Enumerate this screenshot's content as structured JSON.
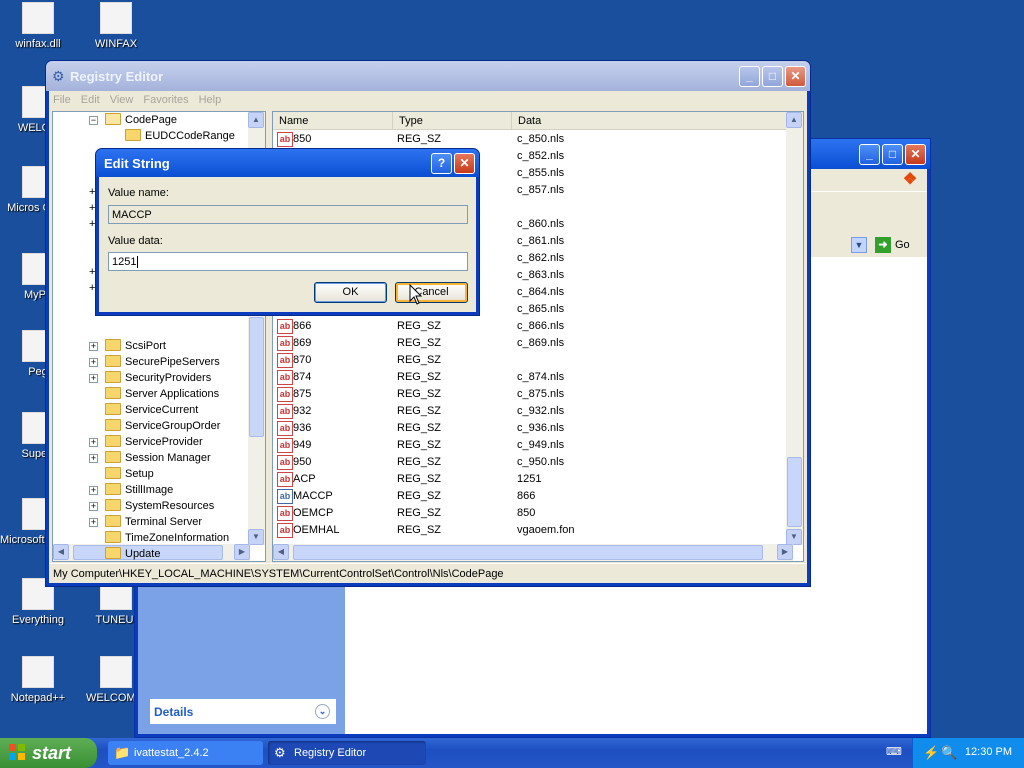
{
  "desktop": {
    "icons": [
      {
        "label": "winfax.dll",
        "icon": "dll-file-icon"
      },
      {
        "label": "WINFAX",
        "icon": "text-document-icon"
      },
      {
        "label": "WELCO",
        "icon": "folder-icon"
      },
      {
        "label": "Micros Outlo",
        "icon": "outlook-icon"
      },
      {
        "label": "MyPa",
        "icon": "mypal-icon"
      },
      {
        "label": "Peg",
        "icon": "pegasus-icon"
      },
      {
        "label": "Superr",
        "icon": "super-icon"
      },
      {
        "label": "Microsoft Studio :",
        "icon": "studio-icon"
      },
      {
        "label": "Everything",
        "icon": "everything-search-icon"
      },
      {
        "label": "TUNEUI",
        "icon": "text-document-icon"
      },
      {
        "label": "Notepad++",
        "icon": "notepadpp-icon"
      },
      {
        "label": "WELCOME.",
        "icon": "text-document-icon"
      }
    ]
  },
  "background_window": {
    "details_label": "Details",
    "go_label": "Go",
    "colors": {
      "title": "#0a4fd4",
      "pane": "#7ba2e7"
    }
  },
  "registry_editor": {
    "title": "Registry Editor",
    "menu": [
      "File",
      "Edit",
      "View",
      "Favorites",
      "Help"
    ],
    "tree_top": [
      {
        "label": "CodePage",
        "expanded": true
      },
      {
        "label": "EUDCCodeRange"
      }
    ],
    "tree_items": [
      {
        "label": "ScsiPort",
        "expander": "+"
      },
      {
        "label": "SecurePipeServers",
        "expander": "+"
      },
      {
        "label": "SecurityProviders",
        "expander": "+"
      },
      {
        "label": "Server Applications",
        "expander": ""
      },
      {
        "label": "ServiceCurrent",
        "expander": ""
      },
      {
        "label": "ServiceGroupOrder",
        "expander": ""
      },
      {
        "label": "ServiceProvider",
        "expander": "+"
      },
      {
        "label": "Session Manager",
        "expander": "+"
      },
      {
        "label": "Setup",
        "expander": ""
      },
      {
        "label": "StillImage",
        "expander": "+"
      },
      {
        "label": "SystemResources",
        "expander": "+"
      },
      {
        "label": "Terminal Server",
        "expander": "+"
      },
      {
        "label": "TimeZoneInformation",
        "expander": ""
      },
      {
        "label": "Update",
        "expander": ""
      }
    ],
    "columns": [
      "Name",
      "Type",
      "Data"
    ],
    "rows": [
      {
        "name": "850",
        "type": "REG_SZ",
        "data": "c_850.nls"
      },
      {
        "name": "",
        "type": "",
        "data": "c_852.nls"
      },
      {
        "name": "",
        "type": "",
        "data": "c_855.nls"
      },
      {
        "name": "",
        "type": "",
        "data": "c_857.nls"
      },
      {
        "name": "",
        "type": "",
        "data": ""
      },
      {
        "name": "",
        "type": "",
        "data": "c_860.nls"
      },
      {
        "name": "",
        "type": "",
        "data": "c_861.nls"
      },
      {
        "name": "",
        "type": "",
        "data": "c_862.nls"
      },
      {
        "name": "",
        "type": "",
        "data": "c_863.nls"
      },
      {
        "name": "",
        "type": "",
        "data": "c_864.nls"
      },
      {
        "name": "",
        "type": "",
        "data": "c_865.nls"
      },
      {
        "name": "866",
        "type": "REG_SZ",
        "data": "c_866.nls"
      },
      {
        "name": "869",
        "type": "REG_SZ",
        "data": "c_869.nls"
      },
      {
        "name": "870",
        "type": "REG_SZ",
        "data": ""
      },
      {
        "name": "874",
        "type": "REG_SZ",
        "data": "c_874.nls"
      },
      {
        "name": "875",
        "type": "REG_SZ",
        "data": "c_875.nls"
      },
      {
        "name": "932",
        "type": "REG_SZ",
        "data": "c_932.nls"
      },
      {
        "name": "936",
        "type": "REG_SZ",
        "data": "c_936.nls"
      },
      {
        "name": "949",
        "type": "REG_SZ",
        "data": "c_949.nls"
      },
      {
        "name": "950",
        "type": "REG_SZ",
        "data": "c_950.nls"
      },
      {
        "name": "ACP",
        "type": "REG_SZ",
        "data": "1251"
      },
      {
        "name": "MACCP",
        "type": "REG_SZ",
        "data": "866"
      },
      {
        "name": "OEMCP",
        "type": "REG_SZ",
        "data": "850"
      },
      {
        "name": "OEMHAL",
        "type": "REG_SZ",
        "data": "vgaoem.fon"
      }
    ],
    "status_path": "My Computer\\HKEY_LOCAL_MACHINE\\SYSTEM\\CurrentControlSet\\Control\\Nls\\CodePage"
  },
  "edit_string": {
    "title": "Edit String",
    "value_name_label": "Value name:",
    "value_name": "MACCP",
    "value_data_label": "Value data:",
    "value_data": "1251",
    "ok_label": "OK",
    "cancel_label": "Cancel"
  },
  "taskbar": {
    "start_label": "start",
    "tasks": [
      {
        "label": "ivattestat_2.4.2",
        "icon": "folder-icon"
      },
      {
        "label": "Registry Editor",
        "icon": "regedit-icon"
      }
    ],
    "clock": "12:30 PM"
  }
}
